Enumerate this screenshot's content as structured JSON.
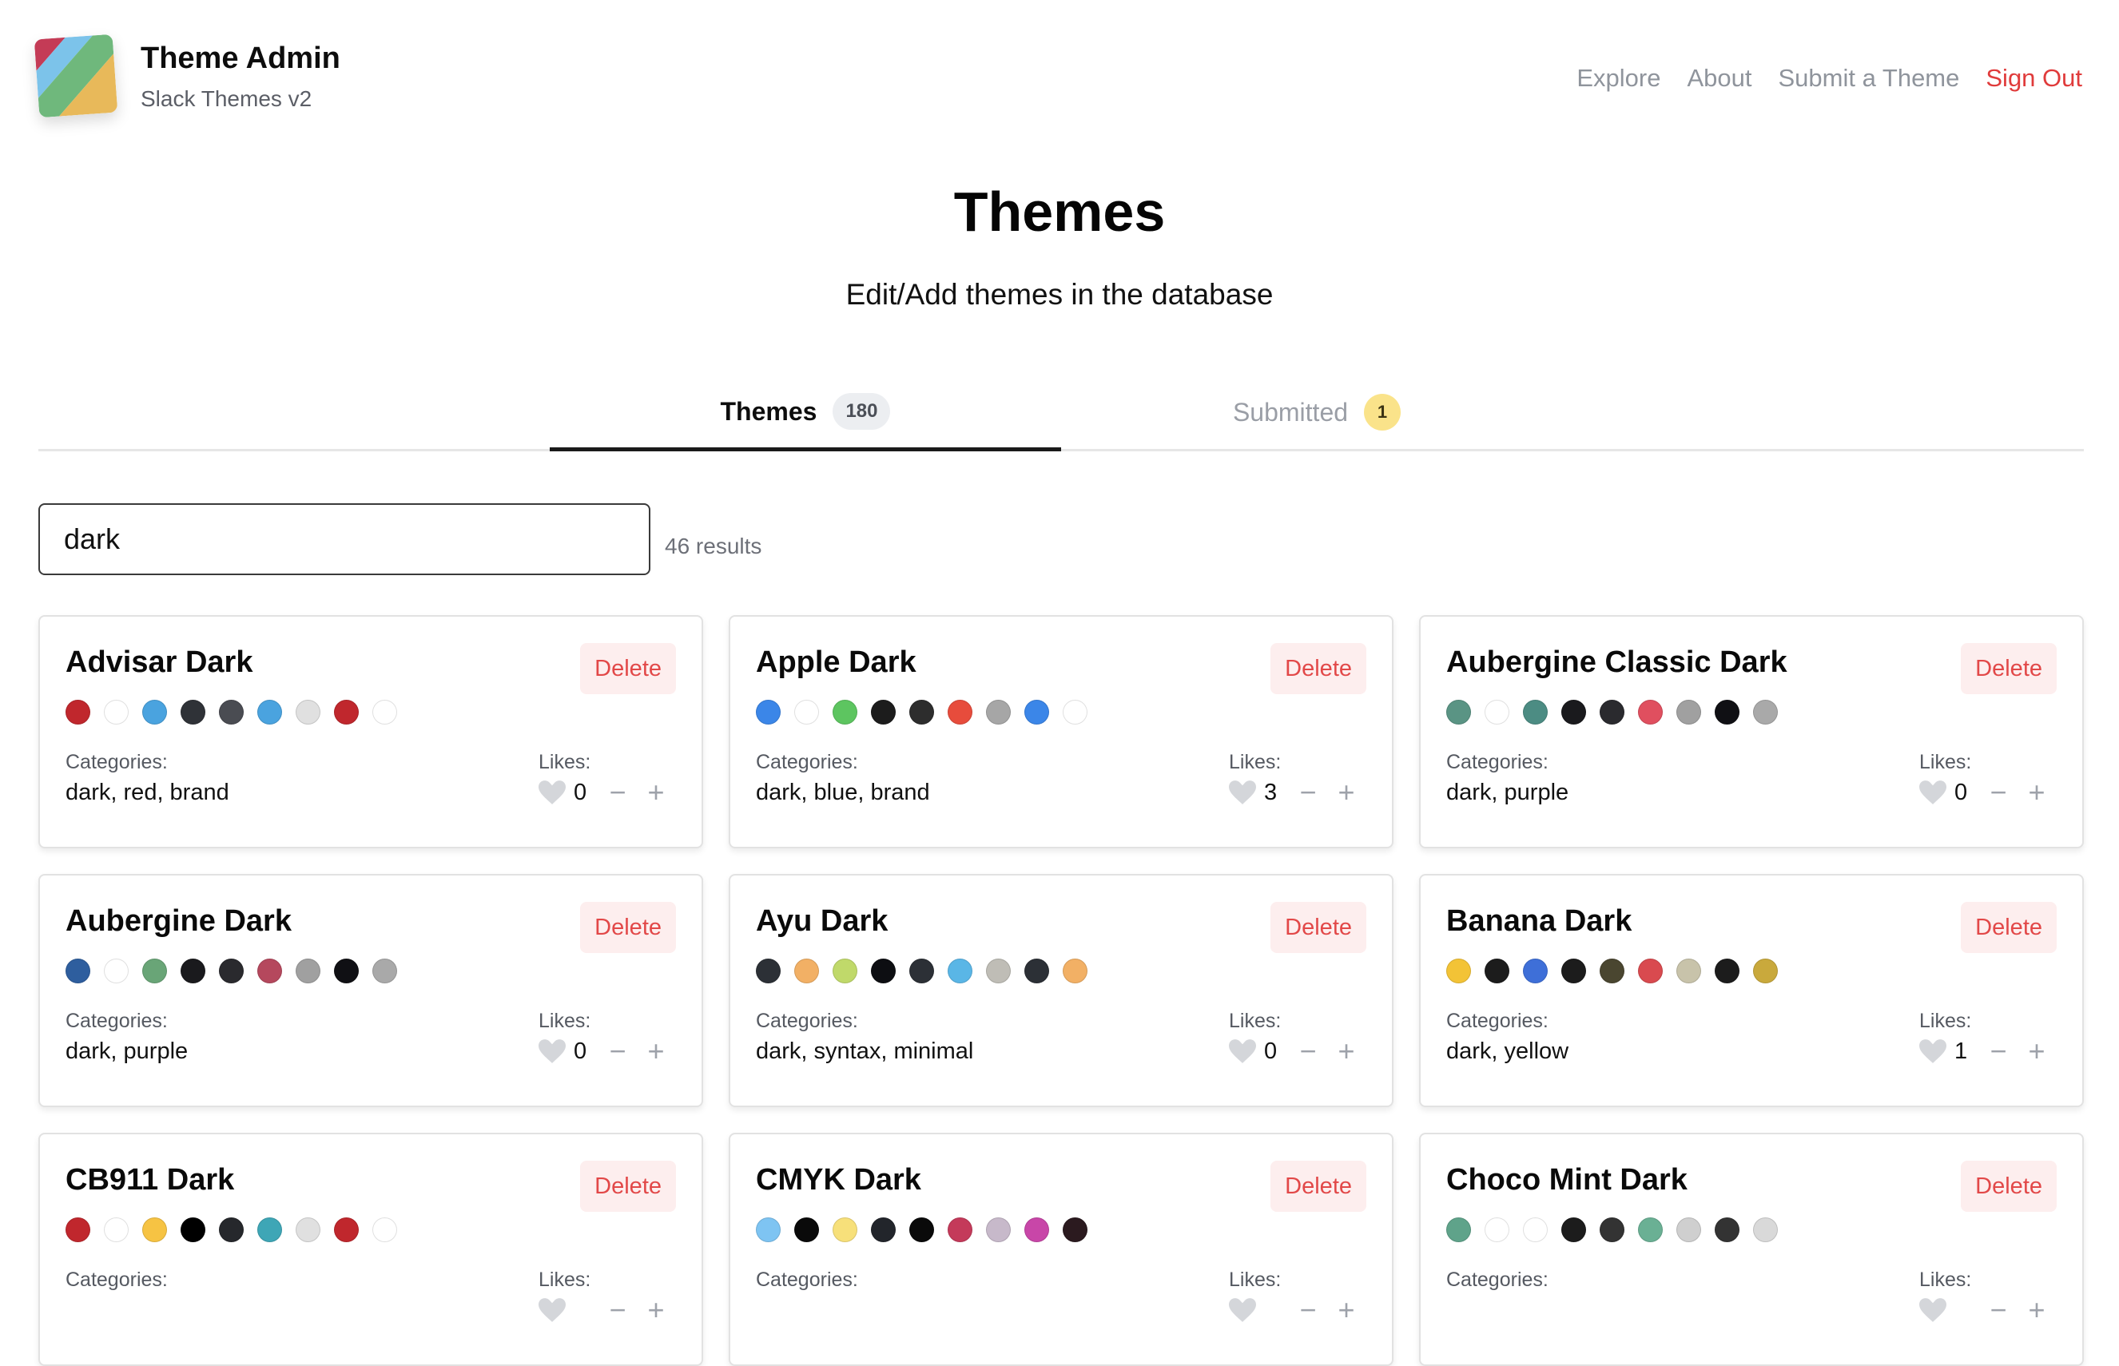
{
  "brand": {
    "title": "Theme Admin",
    "subtitle": "Slack Themes v2"
  },
  "nav": {
    "explore": "Explore",
    "about": "About",
    "submit": "Submit a Theme",
    "signout": "Sign Out"
  },
  "hero": {
    "title": "Themes",
    "subtitle": "Edit/Add themes in the database"
  },
  "tabs": [
    {
      "label": "Themes",
      "count": "180"
    },
    {
      "label": "Submitted",
      "count": "1"
    }
  ],
  "search": {
    "value": "dark",
    "results": "46 results"
  },
  "card_labels": {
    "categories": "Categories:",
    "likes": "Likes:",
    "delete": "Delete"
  },
  "colors": {
    "accent_red": "#e03b3b",
    "delete_bg": "#fdeeee",
    "badge_yellow": "#fae38a"
  },
  "themes": [
    {
      "name": "Advisar Dark",
      "categories": "dark, red, brand",
      "likes": "0",
      "colors": [
        "#c0272d",
        "#ffffff",
        "#4aa3df",
        "#2f3237",
        "#4a4c52",
        "#4aa3df",
        "#e0e0e0",
        "#c0272d",
        "#ffffff"
      ]
    },
    {
      "name": "Apple Dark",
      "categories": "dark, blue, brand",
      "likes": "3",
      "colors": [
        "#3b86e8",
        "#ffffff",
        "#5dc560",
        "#1c1c1c",
        "#2d2d2d",
        "#e74c3c",
        "#a6a6a6",
        "#3b86e8",
        "#ffffff"
      ]
    },
    {
      "name": "Aubergine Classic Dark",
      "categories": "dark, purple",
      "likes": "0",
      "colors": [
        "#5a9484",
        "#ffffff",
        "#4c8c83",
        "#1a1a1d",
        "#2a2a2e",
        "#e04f5f",
        "#a0a0a0",
        "#101014",
        "#a9a9a9"
      ]
    },
    {
      "name": "Aubergine Dark",
      "categories": "dark, purple",
      "likes": "0",
      "colors": [
        "#2e5e9e",
        "#ffffff",
        "#69a577",
        "#1a1a1d",
        "#2a2a2e",
        "#b5485d",
        "#a0a0a0",
        "#101014",
        "#a9a9a9"
      ]
    },
    {
      "name": "Ayu Dark",
      "categories": "dark, syntax, minimal",
      "likes": "0",
      "colors": [
        "#2c3036",
        "#f2b065",
        "#c0d96a",
        "#0d0e12",
        "#2c3036",
        "#5ab6e6",
        "#bfbdb6",
        "#2c3036",
        "#f2b065"
      ]
    },
    {
      "name": "Banana Dark",
      "categories": "dark, yellow",
      "likes": "1",
      "colors": [
        "#f3c336",
        "#1c1c1c",
        "#3e6fd8",
        "#1c1c1c",
        "#4a4630",
        "#d94a4f",
        "#c8c3aa",
        "#1c1c1c",
        "#c9a93c"
      ]
    },
    {
      "name": "CB911 Dark",
      "categories": "",
      "likes": "",
      "colors": [
        "#c0272d",
        "#ffffff",
        "#f6c343",
        "#000000",
        "#26282c",
        "#3ea6b6",
        "#e0e0e0",
        "#c0272d",
        "#ffffff"
      ]
    },
    {
      "name": "CMYK Dark",
      "categories": "",
      "likes": "",
      "colors": [
        "#7ec4f2",
        "#0a0a0a",
        "#f7e07a",
        "#22252b",
        "#0a0a0a",
        "#c43a5a",
        "#c7b9ca",
        "#c846a8",
        "#2b1a1f"
      ]
    },
    {
      "name": "Choco Mint Dark",
      "categories": "",
      "likes": "",
      "colors": [
        "#5fa38a",
        "#ffffff",
        "#ffffff",
        "#1c1c1c",
        "#333333",
        "#6ab094",
        "#cfcfcf",
        "#333333",
        "#d9d9d9"
      ]
    }
  ]
}
